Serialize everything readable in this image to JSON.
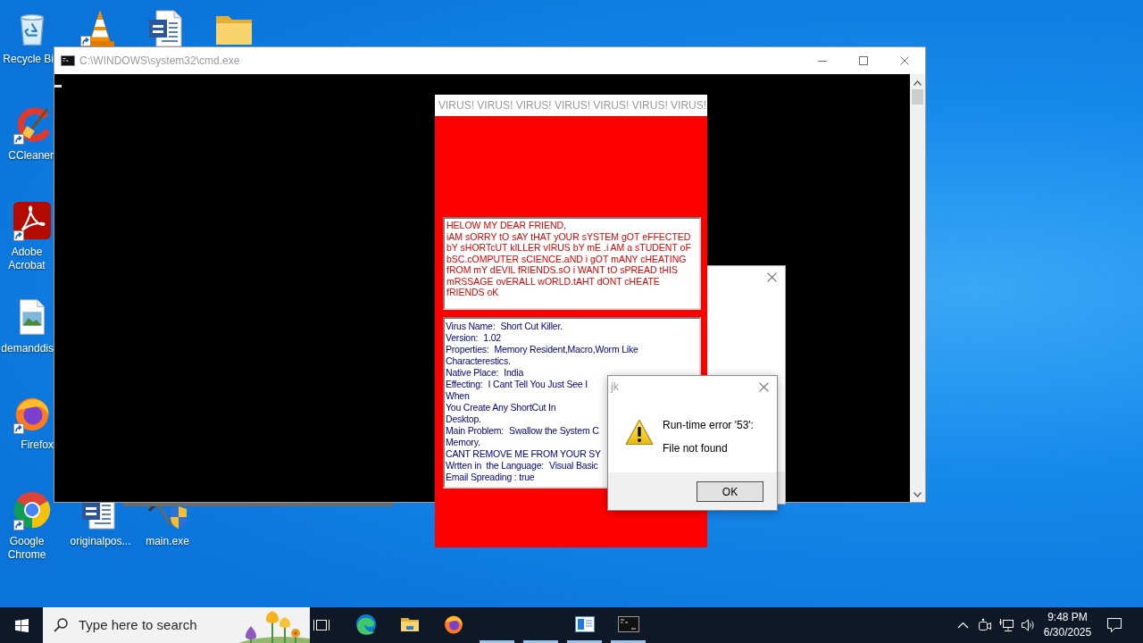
{
  "desktop": {
    "rows": [
      [
        {
          "kind": "recycle-bin",
          "label": "Recycle Bi",
          "shortcut": false
        },
        {
          "kind": "vlc",
          "shortcut": true
        },
        {
          "kind": "word-doc",
          "shortcut": false
        },
        {
          "kind": "folder",
          "shortcut": false
        }
      ],
      [
        {
          "kind": "ccleaner",
          "label": "CCleaner",
          "shortcut": true
        }
      ],
      [
        {
          "kind": "acrobat",
          "label": "Adobe Acrobat",
          "shortcut": true
        }
      ],
      [
        {
          "kind": "image-file",
          "label": "demanddis",
          "shortcut": false
        }
      ],
      [
        {
          "kind": "firefox",
          "label": "Firefox",
          "shortcut": true
        }
      ],
      [
        {
          "kind": "chrome",
          "label": "Google Chrome",
          "shortcut": true
        },
        {
          "kind": "word-doc",
          "label": "originalpos...",
          "shortcut": false
        },
        {
          "kind": "exe",
          "label": "main.exe",
          "shortcut": false
        }
      ]
    ]
  },
  "cmd_window": {
    "title": "C:\\WINDOWS\\system32\\cmd.exe",
    "active": false
  },
  "virus_window": {
    "title": "VIRUS! VIRUS! VIRUS! VIRUS! VIRUS! VIRUS! VIRUS!",
    "active": false,
    "message": "HELOW MY DEAR FRIEND,\niAM sORRY tO sAY tHAT yOUR sYSTEM gOT eFFECTED bY sHORTcUT kILLER vIRUS bY mE .i AM a sTUDENT oF bSC.cOMPUTER sCIENCE.aND i gOT mANY cHEATING fROM mY dEVIL fRIENDS.sO i WANT tO sPREAD tHIS mRSSAGE ovERALL wORLD.tAHT dONT cHEATE fRIENDS oK",
    "details": [
      {
        "kind": "field",
        "label": "Virus Name:",
        "value": "Short Cut Killer."
      },
      {
        "kind": "field",
        "label": "Version:",
        "value": "1.02"
      },
      {
        "kind": "field",
        "label": "Properties:",
        "value": "Memory Resident,Macro,Worm Like"
      },
      {
        "kind": "line",
        "text": "Characterestics."
      },
      {
        "kind": "field",
        "label": "Native Place:",
        "value": "India"
      },
      {
        "kind": "field",
        "label": "Effecting:",
        "value": "I Cant Tell You Just See I"
      },
      {
        "kind": "line",
        "text": "When"
      },
      {
        "kind": "line",
        "text": "You Create Any ShortCut In"
      },
      {
        "kind": "line",
        "text": "Desktop."
      },
      {
        "kind": "field",
        "label": "Main Problem:",
        "value": "Swallow the System C"
      },
      {
        "kind": "line",
        "text": "Memory."
      },
      {
        "kind": "line",
        "text": "CANT REMOVE ME FROM YOUR SY"
      },
      {
        "kind": "field",
        "label": "Wrtten in  the Language:",
        "value": "Visual Basic"
      },
      {
        "kind": "line",
        "text": "Email Spreading : true"
      }
    ]
  },
  "error_dialog": {
    "title": "jk",
    "active": false,
    "heading": "Run-time error '53':",
    "message": "File not found",
    "button": "OK"
  },
  "taskbar": {
    "search": {
      "placeholder": "Type here to search"
    },
    "apps": [
      {
        "kind": "edge",
        "running": false
      },
      {
        "kind": "file-explorer",
        "running": false
      },
      {
        "kind": "firefox",
        "running": false
      },
      {
        "kind": "blank",
        "running": true
      },
      {
        "kind": "blank",
        "running": true
      },
      {
        "kind": "form-window",
        "running": true
      },
      {
        "kind": "console",
        "running": true
      }
    ],
    "clock": {
      "time": "9:48 PM",
      "date": "6/30/2025"
    }
  }
}
